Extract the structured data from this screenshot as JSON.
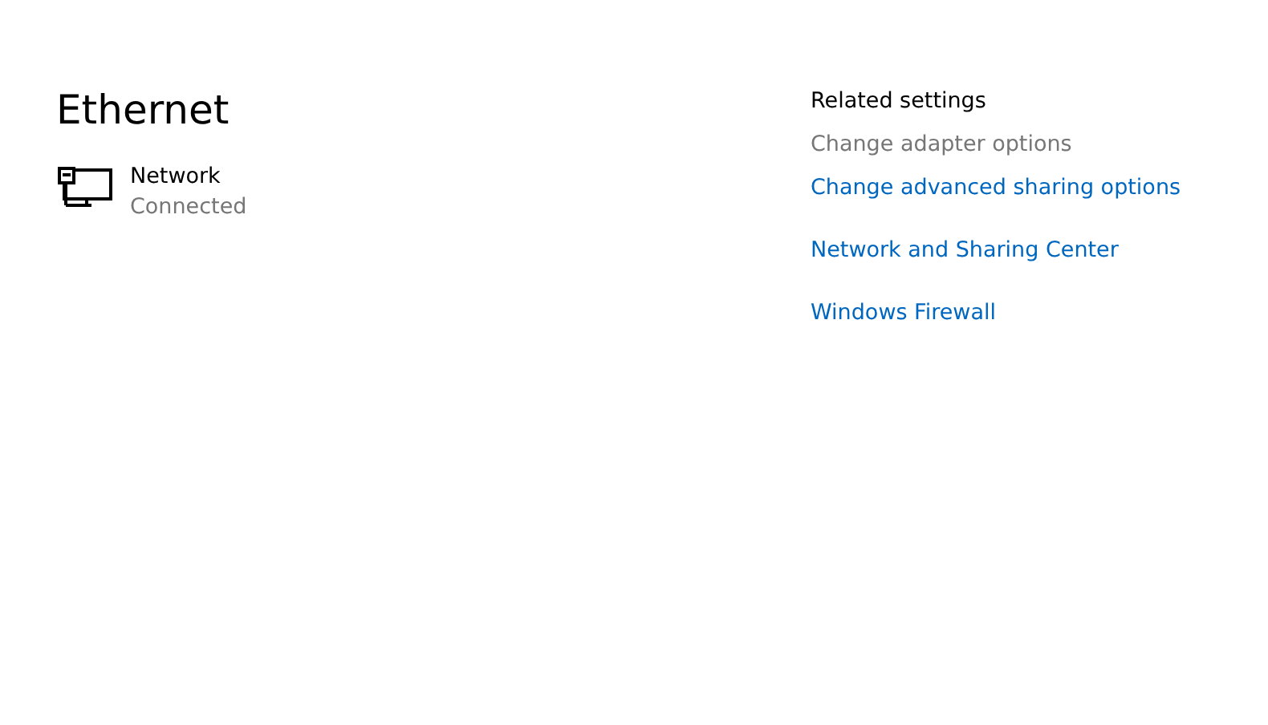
{
  "page": {
    "title": "Ethernet"
  },
  "network": {
    "name": "Network",
    "status": "Connected"
  },
  "related_settings": {
    "heading": "Related settings",
    "links": [
      {
        "label": "Change adapter options",
        "disabled": true
      },
      {
        "label": "Change advanced sharing options",
        "disabled": false
      },
      {
        "label": "Network and Sharing Center",
        "disabled": false
      },
      {
        "label": "Windows Firewall",
        "disabled": false
      }
    ]
  }
}
